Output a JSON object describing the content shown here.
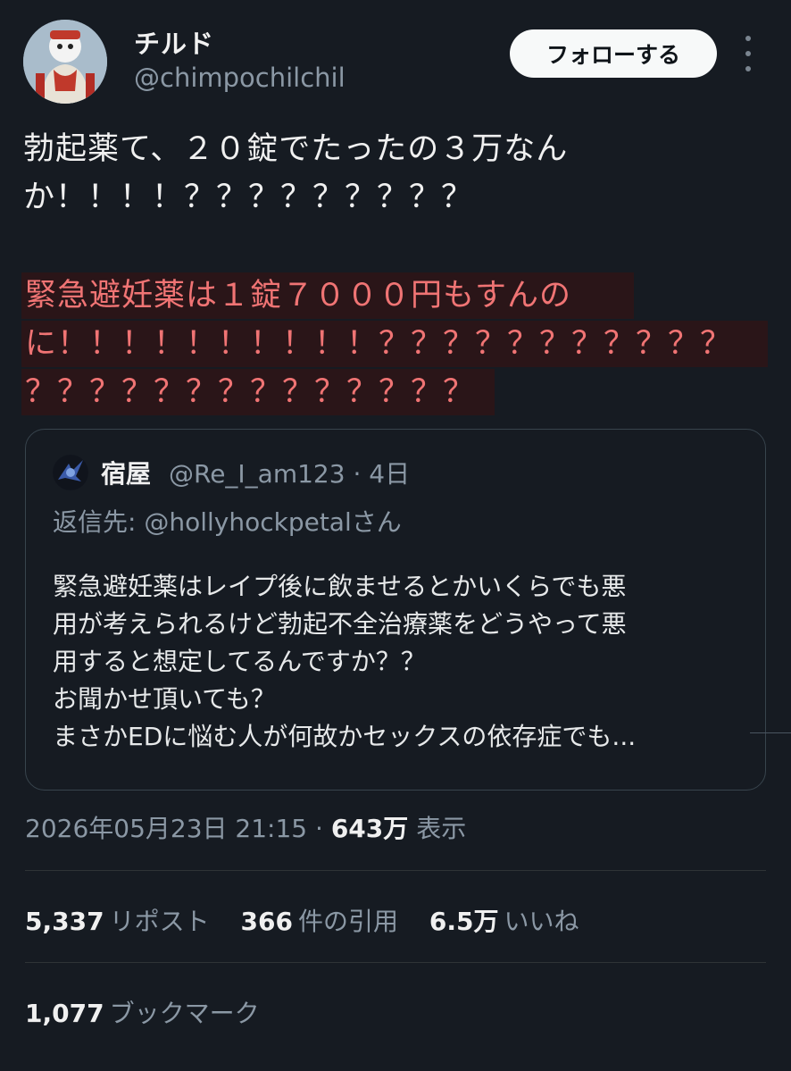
{
  "author": {
    "display_name": "チルド",
    "handle": "@chimpochilchil",
    "avatar_icon": "avatar-icon"
  },
  "follow_button_label": "フォローする",
  "tweet": {
    "lines": [
      "勃起薬て、２０錠でたったの３万なん",
      "か！！！！？？？？？？？？？"
    ],
    "highlight_lines": [
      "緊急避妊薬は１錠７０００円もすんの",
      "に！！！！！！！！！！？？？？？？？？？？？",
      "？？？？？？？？？？？？？？"
    ],
    "highlight_color": "#f07474"
  },
  "quote": {
    "name": "宿屋",
    "meta": "@Re_I_am123 · 4日",
    "reply_to": "返信先: @hollyhockpetalさん",
    "body_lines": [
      "緊急避妊薬はレイプ後に飲ませるとかいくらでも悪",
      "用が考えられるけど勃起不全治療薬をどうやって悪",
      "用すると想定してるんですか？？",
      "お聞かせ頂いても？",
      "まさかEDに悩む人が何故かセックスの依存症でも..."
    ]
  },
  "timestamp": "2026年05月23日 21:15 ·",
  "views_count": "643万",
  "views_label": "表示",
  "stats": {
    "reposts_count": "5,337",
    "reposts_label": "リポスト",
    "quotes_count": "366",
    "quotes_label": "件の引用",
    "likes_count": "6.5万",
    "likes_label": "いいね",
    "bookmarks_count": "1,077",
    "bookmarks_label": "ブックマーク"
  }
}
